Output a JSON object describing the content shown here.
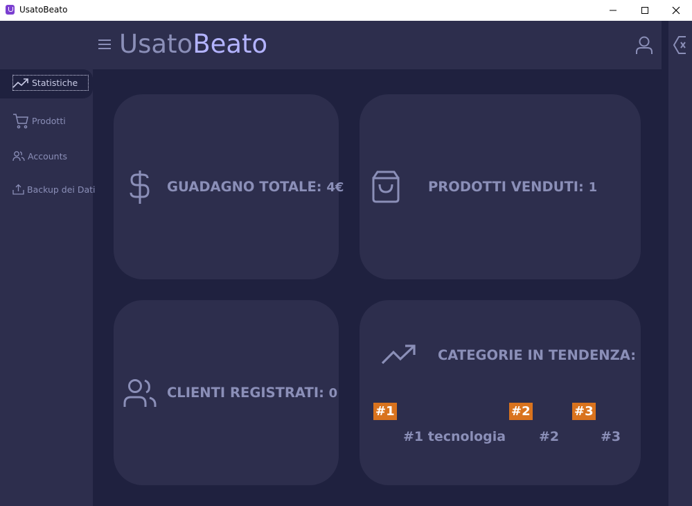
{
  "window": {
    "title": "UsatoBeato"
  },
  "header": {
    "brand_part1": "Usato",
    "brand_part2": "Beato"
  },
  "sidebar": {
    "items": [
      {
        "label": "Statistiche",
        "icon": "trending-up-icon",
        "active": true
      },
      {
        "label": "Prodotti",
        "icon": "cart-icon"
      },
      {
        "label": "Accounts",
        "icon": "users-icon"
      },
      {
        "label": "Backup dei Dati",
        "icon": "upload-icon"
      }
    ]
  },
  "cards": {
    "revenue": {
      "label": "GUADAGNO TOTALE:",
      "value": "4€",
      "icon": "dollar-icon"
    },
    "products_sold": {
      "label": "PRODOTTI VENDUTI:",
      "value": "1",
      "icon": "shopping-bag-icon"
    },
    "clients": {
      "label": "CLIENTI REGISTRATI:",
      "value": "0",
      "icon": "users-icon"
    },
    "trending": {
      "label": "CATEGORIE IN TENDENZA:",
      "icon": "trending-up-icon",
      "badges": [
        "#1",
        "#2",
        "#3"
      ],
      "ranks": [
        "#1 tecnologia",
        "#2",
        "#3"
      ]
    }
  },
  "colors": {
    "background": "#1f213f",
    "panel": "#2d2e4d",
    "text": "#8b8fb8",
    "brand_accent": "#b3b3ff",
    "badge": "#d9731e"
  }
}
